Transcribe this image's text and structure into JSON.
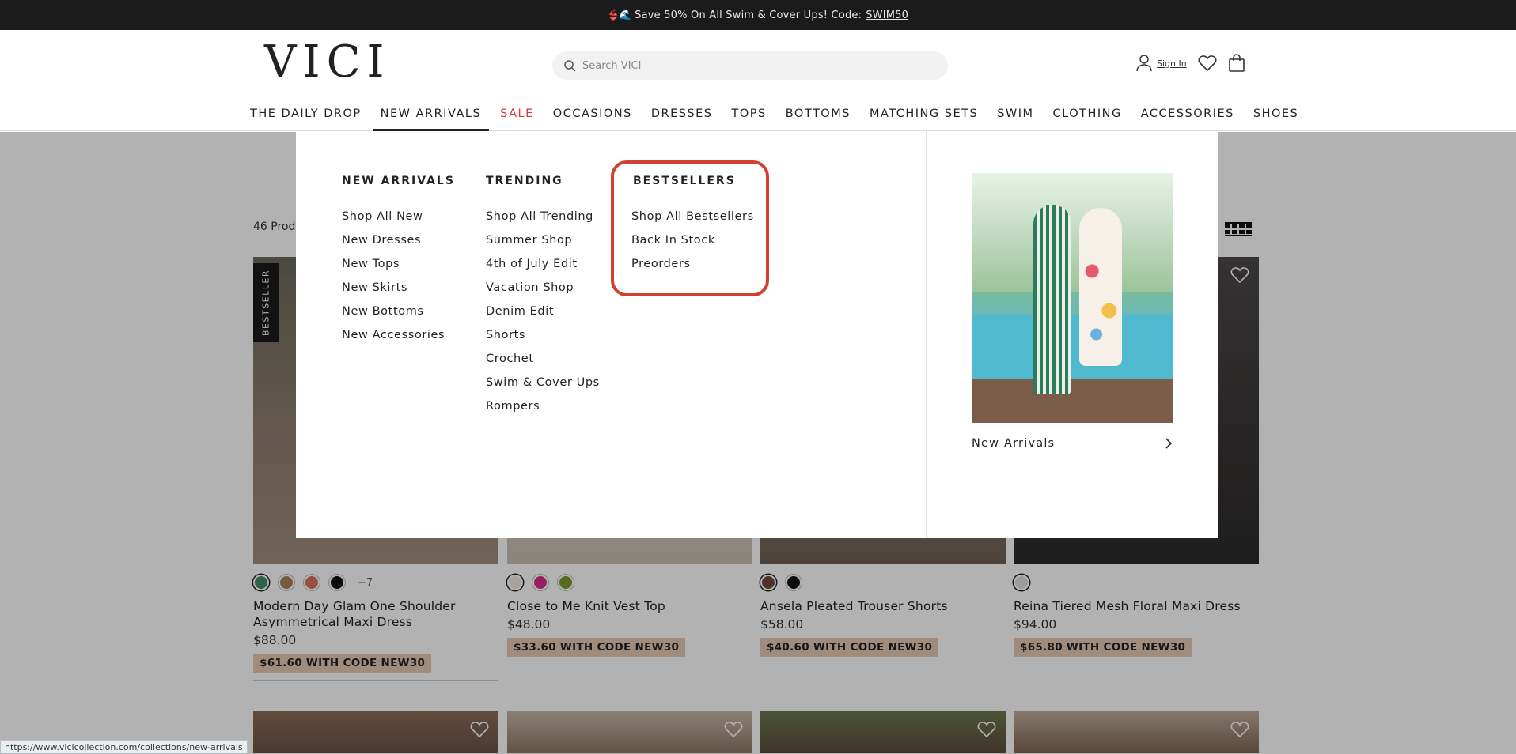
{
  "promo": {
    "text": "Save 50% On All Swim & Cover Ups! Code:",
    "code": "SWIM50",
    "emoji": "👙🌊"
  },
  "header": {
    "logo": "VICI",
    "search_placeholder": "Search VICI",
    "signin_label": "Sign In"
  },
  "nav": {
    "items": [
      "THE DAILY DROP",
      "NEW ARRIVALS",
      "SALE",
      "OCCASIONS",
      "DRESSES",
      "TOPS",
      "BOTTOMS",
      "MATCHING SETS",
      "SWIM",
      "CLOTHING",
      "ACCESSORIES",
      "SHOES"
    ]
  },
  "page": {
    "count": "46 Prod"
  },
  "products": [
    {
      "badge": "BESTSELLER",
      "name": "Modern Day Glam One Shoulder Asymmetrical Maxi Dress",
      "price": "$88.00",
      "code": "$61.60 WITH CODE NEW30",
      "more": "+7",
      "swatches": [
        "#3f8f6a",
        "#a9835a",
        "#d7715d",
        "#111111"
      ]
    },
    {
      "badge": "",
      "name": "Close to Me Knit Vest Top",
      "price": "$48.00",
      "code": "$33.60 WITH CODE NEW30",
      "more": "",
      "swatches": [
        "#efe9df",
        "#d6308e",
        "#7f9a33"
      ]
    },
    {
      "badge": "",
      "name": "Ansela Pleated Trouser Shorts",
      "price": "$58.00",
      "code": "$40.60 WITH CODE NEW30",
      "more": "",
      "swatches": [
        "#6a4a3c",
        "#111111"
      ]
    },
    {
      "badge": "",
      "name": "Reina Tiered Mesh Floral Maxi Dress",
      "price": "$94.00",
      "code": "$65.80 WITH CODE NEW30",
      "more": "",
      "swatches": [
        "#e3e0db"
      ]
    }
  ],
  "mega": {
    "new_arrivals": {
      "heading": "NEW ARRIVALS",
      "links": [
        "Shop All New",
        "New Dresses",
        "New Tops",
        "New Skirts",
        "New Bottoms",
        "New Accessories"
      ]
    },
    "trending": {
      "heading": "TRENDING",
      "links": [
        "Shop All Trending",
        "Summer Shop",
        "4th of July Edit",
        "Vacation Shop",
        "Denim Edit",
        "Shorts",
        "Crochet",
        "Swim & Cover Ups",
        "Rompers"
      ]
    },
    "bestsellers": {
      "heading": "BESTSELLERS",
      "links": [
        "Shop All Bestsellers",
        "Back In Stock",
        "Preorders"
      ]
    },
    "promo_label": "New Arrivals"
  },
  "statusbar": {
    "url": "https://www.vicicollection.com/collections/new-arrivals"
  },
  "colors": {
    "accent_red": "#d9393f",
    "highlight": "#d2402f",
    "code_bg": "#e6c9b4"
  }
}
